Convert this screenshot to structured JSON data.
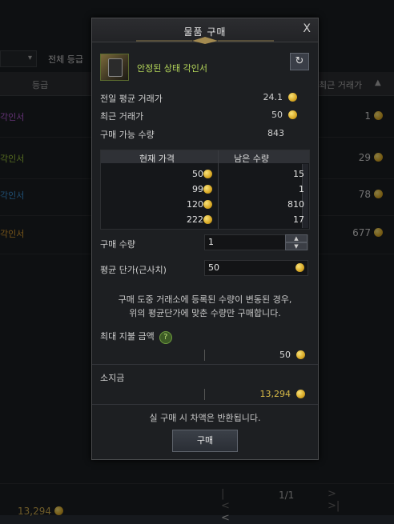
{
  "background": {
    "filter_label": "전체 등급",
    "col_grade": "등급",
    "col_recent": "최근 거래가",
    "rows": [
      {
        "name": "각인서",
        "price": "1",
        "color": "#b45bd4"
      },
      {
        "name": "각인서",
        "price": "29",
        "color": "#9ac23a"
      },
      {
        "name": "각인서",
        "price": "78",
        "color": "#3a8ed0"
      },
      {
        "name": "각인서",
        "price": "677",
        "color": "#d79a2e"
      }
    ],
    "pager": {
      "first": "|<",
      "prev": "<",
      "page": "1/1",
      "next": ">",
      "last": ">|"
    },
    "money": "13,294"
  },
  "modal": {
    "title": "물품 구매",
    "close": "X",
    "item_name": "안정된 상태 각인서",
    "prev_avg_label": "전일 평균 거래가",
    "prev_avg_value": "24.1",
    "recent_label": "최근 거래가",
    "recent_value": "50",
    "buyable_label": "구매 가능 수량",
    "buyable_value": "843",
    "table": {
      "col_price": "현재 가격",
      "col_qty": "남은 수량",
      "rows": [
        {
          "price": "50",
          "qty": "15"
        },
        {
          "price": "99",
          "qty": "1"
        },
        {
          "price": "120",
          "qty": "810"
        },
        {
          "price": "222",
          "qty": "17"
        }
      ]
    },
    "quantity_label": "구매 수량",
    "quantity_value": "1",
    "unit_label": "평균 단가(근사치)",
    "unit_value": "50",
    "notice_line1": "구매 도중 거래소에 등록된 수량이 변동된 경우,",
    "notice_line2": "위의 평균단가에 맞춘 수량만 구매합니다.",
    "max_label": "최대 지불 금액",
    "help": "?",
    "max_value": "50",
    "owned_label": "소지금",
    "owned_value": "13,294",
    "refund_notice": "실 구매 시 차액은 반환됩니다.",
    "buy_label": "구매"
  },
  "colors": {
    "item_name": "#b6d85a",
    "gold": "#d8a825",
    "owned_money": "#d9bb48"
  }
}
